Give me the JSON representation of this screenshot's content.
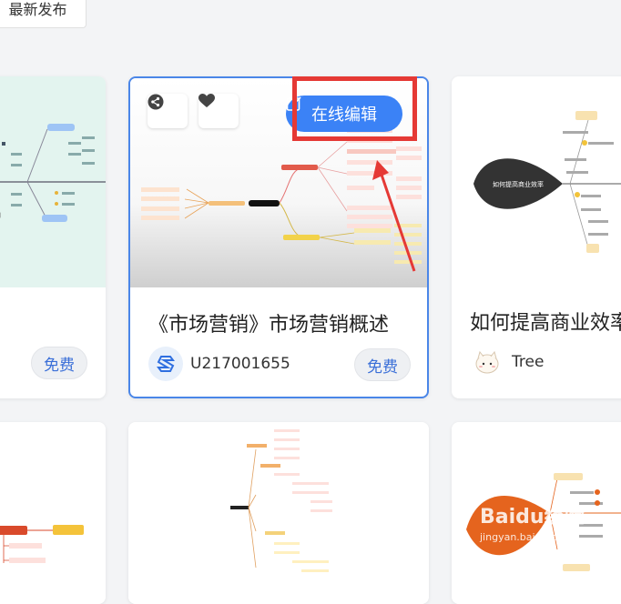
{
  "toolbar": {
    "sort_label": "最新发布"
  },
  "cards": [
    {
      "free_label": "免费"
    },
    {
      "title": "《市场营销》市场营销概述",
      "author": "U217001655",
      "free_label": "免费",
      "edit_label": "在线编辑"
    },
    {
      "title": "如何提高商业效率",
      "author": "Tree",
      "thumb_title": "如何提高商业效率"
    }
  ],
  "watermark": {
    "brand": "Baidu经验",
    "url": "jingyan.baidu.com"
  },
  "colors": {
    "accent": "#3b82f6",
    "highlight": "#e53935",
    "free_text": "#3a6fd8"
  }
}
